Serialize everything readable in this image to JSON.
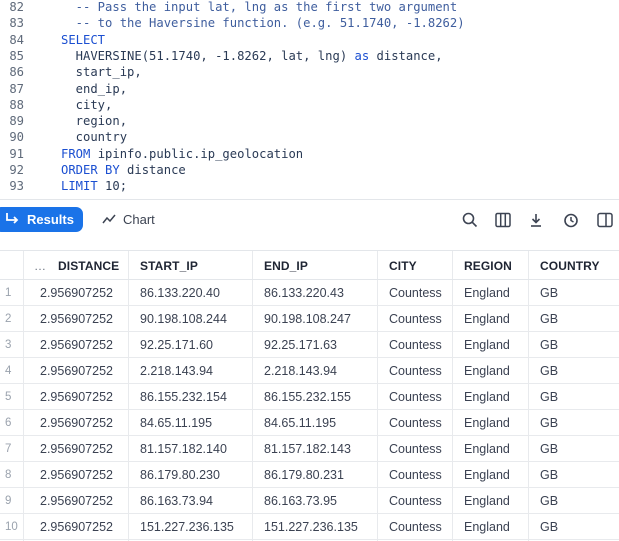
{
  "editor": {
    "lines": [
      {
        "num": "82",
        "parts": [
          {
            "t": "  -- Pass the input lat, lng as the first two argument",
            "c": "cm"
          }
        ]
      },
      {
        "num": "83",
        "parts": [
          {
            "t": "  -- to the Haversine function. (e.g. 51.1740, -1.8262)",
            "c": "cm"
          }
        ]
      },
      {
        "num": "84",
        "parts": [
          {
            "t": "SELECT",
            "c": "kw"
          }
        ]
      },
      {
        "num": "85",
        "parts": [
          {
            "t": "  HAVERSINE(51.1740, -1.8262, lat, lng) ",
            "c": "tx"
          },
          {
            "t": "as",
            "c": "kw"
          },
          {
            "t": " distance,",
            "c": "tx"
          }
        ]
      },
      {
        "num": "86",
        "parts": [
          {
            "t": "  start_ip,",
            "c": "tx"
          }
        ]
      },
      {
        "num": "87",
        "parts": [
          {
            "t": "  end_ip,",
            "c": "tx"
          }
        ]
      },
      {
        "num": "88",
        "parts": [
          {
            "t": "  city,",
            "c": "tx"
          }
        ]
      },
      {
        "num": "89",
        "parts": [
          {
            "t": "  region,",
            "c": "tx"
          }
        ]
      },
      {
        "num": "90",
        "parts": [
          {
            "t": "  country",
            "c": "tx"
          }
        ]
      },
      {
        "num": "91",
        "parts": [
          {
            "t": "FROM",
            "c": "kw"
          },
          {
            "t": " ipinfo.public.ip_geolocation",
            "c": "tx"
          }
        ]
      },
      {
        "num": "92",
        "parts": [
          {
            "t": "ORDER BY",
            "c": "kw"
          },
          {
            "t": " distance",
            "c": "tx"
          }
        ]
      },
      {
        "num": "93",
        "parts": [
          {
            "t": "LIMIT",
            "c": "kw"
          },
          {
            "t": " 10;",
            "c": "tx"
          }
        ]
      }
    ]
  },
  "toolbar": {
    "results_label": "Results",
    "chart_label": "Chart",
    "accent": "#1a73e8",
    "icons": [
      "search-icon",
      "columns-icon",
      "download-icon",
      "history-icon",
      "panel-icon"
    ]
  },
  "table": {
    "menu_glyph": "…",
    "columns": [
      "DISTANCE",
      "START_IP",
      "END_IP",
      "CITY",
      "REGION",
      "COUNTRY"
    ],
    "rows": [
      {
        "n": "1",
        "v": [
          "2.956907252",
          "86.133.220.40",
          "86.133.220.43",
          "Countess",
          "England",
          "GB"
        ]
      },
      {
        "n": "2",
        "v": [
          "2.956907252",
          "90.198.108.244",
          "90.198.108.247",
          "Countess",
          "England",
          "GB"
        ]
      },
      {
        "n": "3",
        "v": [
          "2.956907252",
          "92.25.171.60",
          "92.25.171.63",
          "Countess",
          "England",
          "GB"
        ]
      },
      {
        "n": "4",
        "v": [
          "2.956907252",
          "2.218.143.94",
          "2.218.143.94",
          "Countess",
          "England",
          "GB"
        ]
      },
      {
        "n": "5",
        "v": [
          "2.956907252",
          "86.155.232.154",
          "86.155.232.155",
          "Countess",
          "England",
          "GB"
        ]
      },
      {
        "n": "6",
        "v": [
          "2.956907252",
          "84.65.11.195",
          "84.65.11.195",
          "Countess",
          "England",
          "GB"
        ]
      },
      {
        "n": "7",
        "v": [
          "2.956907252",
          "81.157.182.140",
          "81.157.182.143",
          "Countess",
          "England",
          "GB"
        ]
      },
      {
        "n": "8",
        "v": [
          "2.956907252",
          "86.179.80.230",
          "86.179.80.231",
          "Countess",
          "England",
          "GB"
        ]
      },
      {
        "n": "9",
        "v": [
          "2.956907252",
          "86.163.73.94",
          "86.163.73.95",
          "Countess",
          "England",
          "GB"
        ]
      },
      {
        "n": "10",
        "v": [
          "2.956907252",
          "151.227.236.135",
          "151.227.236.135",
          "Countess",
          "England",
          "GB"
        ]
      }
    ]
  }
}
